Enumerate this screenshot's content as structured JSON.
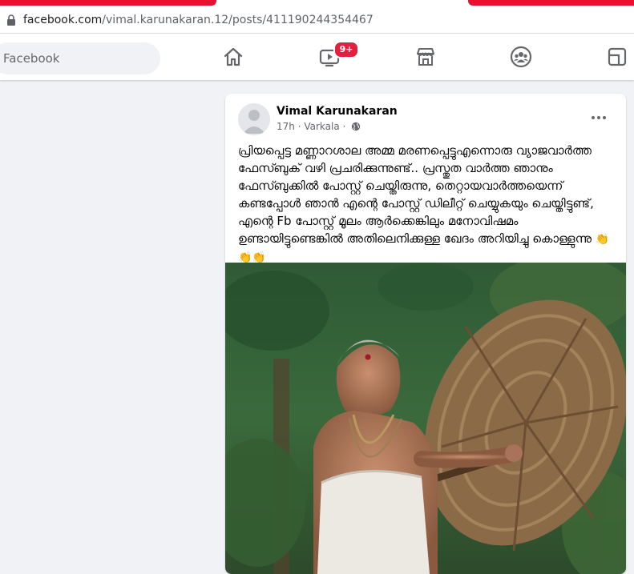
{
  "browser": {
    "url_domain": "facebook.com",
    "url_path": "/vimal.karunakaran.12/posts/411190244354467"
  },
  "nav": {
    "search_placeholder": "Facebook",
    "video_badge": "9+"
  },
  "post": {
    "author": "Vimal Karunakaran",
    "time": "17h",
    "separator": "·",
    "location": "Varkala",
    "text": "പ്രിയപ്പെട്ട മണ്ണാറശാല അമ്മ മരണപ്പെട്ടുഎന്നൊരു വ്യാജവാർത്ത ഫേസ്ബുക് വഴി പ്രചരിക്കുന്നുണ്ട്.. പ്രസ്തുത വാർത്ത ഞാനും ഫേസ്ബുക്കിൽ പോസ്റ്റ് ചെയ്തിരുന്നു, തെറ്റായവാർത്തയെന്ന് കണ്ടപ്പോൾ ഞാൻ എന്റെ പോസ്റ്റ് ഡിലീറ്റ് ചെയ്യുകയും ചെയ്തിട്ടുണ്ട്, എന്റെ Fb പോസ്റ്റ് മൂലം ആർക്കെങ്കിലും മനോവിഷമം ഉണ്ടായിട്ടുണ്ടെങ്കിൽ അതിലെനിക്കുള്ള ഖേദം അറിയിച്ചു കൊള്ളുന്നു",
    "emoji": "👏👏👏"
  },
  "colors": {
    "accent_red": "#e8102e",
    "badge_red": "#e41e3f",
    "page_bg": "#f0f2f5"
  }
}
